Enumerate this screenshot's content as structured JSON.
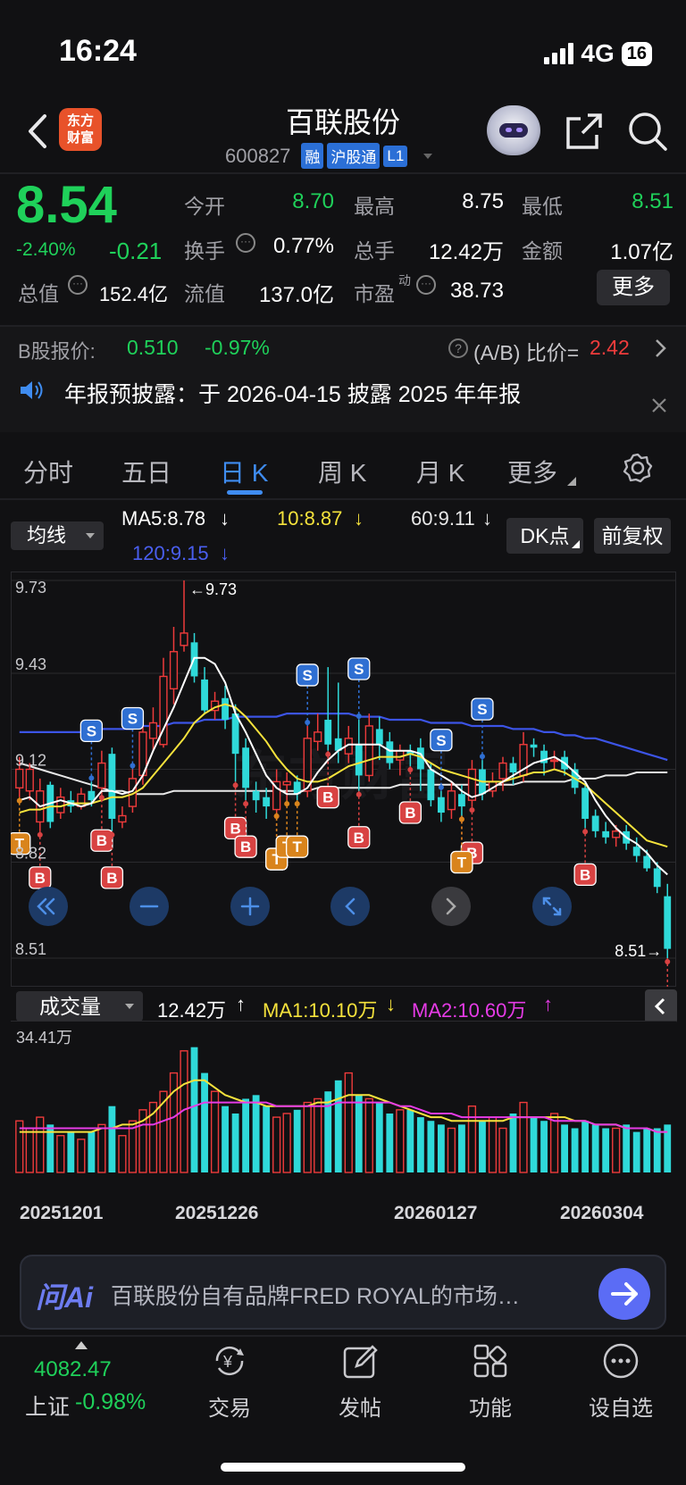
{
  "status_bar": {
    "time": "16:24",
    "network": "4G",
    "battery": "16"
  },
  "header": {
    "logo_text": [
      "东方",
      "财富"
    ],
    "stock_name": "百联股份",
    "stock_code": "600827",
    "tags": [
      "融",
      "沪股通",
      "L1"
    ]
  },
  "quote": {
    "price": "8.54",
    "change_pct": "-2.40%",
    "change": "-0.21",
    "fields": [
      {
        "label": "今开",
        "value": "8.70",
        "color": "green"
      },
      {
        "label": "最高",
        "value": "8.75",
        "color": "white"
      },
      {
        "label": "最低",
        "value": "8.51",
        "color": "green"
      },
      {
        "label": "换手",
        "value": "0.77%",
        "color": "white"
      },
      {
        "label": "总手",
        "value": "12.42万",
        "color": "white"
      },
      {
        "label": "金额",
        "value": "1.07亿",
        "color": "white"
      },
      {
        "label": "总值",
        "value": "152.4亿",
        "color": "white"
      },
      {
        "label": "流值",
        "value": "137.0亿",
        "color": "white"
      },
      {
        "label": "市盈",
        "superscript": "动",
        "value": "38.73",
        "color": "white"
      }
    ],
    "more_label": "更多"
  },
  "b_share": {
    "label": "B股报价:",
    "price": "0.510",
    "change_pct": "-0.97%",
    "ratio_label": "(A/B) 比价=",
    "ratio_value": "2.42"
  },
  "notice": {
    "text": "年报预披露：于 2026-04-15 披露 2025 年年报"
  },
  "tabs": [
    {
      "label": "分时",
      "active": false
    },
    {
      "label": "五日",
      "active": false
    },
    {
      "label": "日 K",
      "active": true
    },
    {
      "label": "周 K",
      "active": false
    },
    {
      "label": "月 K",
      "active": false
    },
    {
      "label": "更多",
      "active": false
    }
  ],
  "indicators": {
    "ma_select": "均线",
    "ma5": "MA5:8.78",
    "ma10": "10:8.87",
    "ma60": "60:9.11",
    "ma120": "120:9.15",
    "dk_label": "DK点",
    "fq_label": "前复权",
    "colors": {
      "ma5": "#ffffff",
      "ma10": "#f5e23c",
      "ma60": "#e8e8e8",
      "ma120": "#3c54e6",
      "up": "#ee3b3b",
      "down": "#2fd9d9"
    }
  },
  "price_axis": {
    "labels": [
      "9.73",
      "9.43",
      "9.12",
      "8.82",
      "8.51"
    ],
    "high_marker": "9.73",
    "low_marker": "8.51"
  },
  "volume": {
    "select": "成交量",
    "current": "12.42万",
    "ma1": "MA1:10.10万",
    "ma2": "MA2:10.60万",
    "max_label": "34.41万"
  },
  "dates": [
    "20251201",
    "20251226",
    "20260127",
    "20260304"
  ],
  "chart_data": {
    "type": "candlestick",
    "ylim": [
      8.51,
      9.73
    ],
    "candles": [
      [
        9.06,
        9.12,
        9.16,
        9.03
      ],
      [
        9.05,
        9.12,
        9.14,
        9.02
      ],
      [
        8.95,
        9.05,
        9.09,
        8.92
      ],
      [
        9.07,
        8.95,
        9.08,
        8.93
      ],
      [
        8.98,
        9.03,
        9.06,
        8.96
      ],
      [
        9.02,
        9.0,
        9.05,
        8.98
      ],
      [
        9.0,
        9.04,
        9.06,
        8.99
      ],
      [
        9.05,
        9.02,
        9.08,
        9.0
      ],
      [
        9.06,
        9.14,
        9.18,
        9.04
      ],
      [
        9.17,
        8.96,
        9.19,
        8.92
      ],
      [
        8.95,
        8.97,
        9.0,
        8.93
      ],
      [
        9.0,
        9.09,
        9.12,
        8.98
      ],
      [
        9.1,
        9.24,
        9.26,
        9.07
      ],
      [
        9.22,
        9.27,
        9.32,
        9.18
      ],
      [
        9.2,
        9.42,
        9.48,
        9.19
      ],
      [
        9.38,
        9.5,
        9.58,
        9.33
      ],
      [
        9.52,
        9.56,
        9.73,
        9.5
      ],
      [
        9.53,
        9.42,
        9.56,
        9.4
      ],
      [
        9.41,
        9.31,
        9.45,
        9.3
      ],
      [
        9.31,
        9.34,
        9.37,
        9.28
      ],
      [
        9.35,
        9.28,
        9.39,
        9.25
      ],
      [
        9.3,
        9.17,
        9.33,
        9.08
      ],
      [
        9.19,
        9.06,
        9.22,
        9.02
      ],
      [
        9.05,
        9.02,
        9.08,
        8.98
      ],
      [
        9.03,
        9.0,
        9.06,
        8.96
      ],
      [
        8.99,
        9.08,
        9.12,
        8.98
      ],
      [
        9.07,
        9.08,
        9.11,
        9.02
      ],
      [
        9.08,
        9.04,
        9.1,
        9.02
      ],
      [
        9.05,
        9.22,
        9.26,
        9.03
      ],
      [
        9.21,
        9.24,
        9.3,
        9.18
      ],
      [
        9.28,
        9.2,
        9.45,
        9.18
      ],
      [
        9.22,
        9.18,
        9.4,
        9.14
      ],
      [
        9.17,
        9.22,
        9.26,
        9.14
      ],
      [
        9.2,
        9.1,
        9.28,
        9.05
      ],
      [
        9.1,
        9.26,
        9.3,
        9.08
      ],
      [
        9.25,
        9.2,
        9.29,
        9.15
      ],
      [
        9.21,
        9.14,
        9.24,
        9.12
      ],
      [
        9.15,
        9.18,
        9.2,
        9.1
      ],
      [
        9.18,
        9.17,
        9.2,
        9.13
      ],
      [
        9.19,
        9.12,
        9.22,
        9.05
      ],
      [
        9.12,
        9.02,
        9.14,
        9.0
      ],
      [
        9.03,
        8.98,
        9.05,
        8.95
      ],
      [
        8.99,
        9.05,
        9.08,
        8.96
      ],
      [
        9.04,
        9.0,
        9.07,
        8.97
      ],
      [
        9.02,
        9.12,
        9.15,
        9.0
      ],
      [
        9.12,
        9.04,
        9.15,
        9.02
      ],
      [
        9.05,
        9.08,
        9.11,
        9.03
      ],
      [
        9.09,
        9.14,
        9.16,
        9.05
      ],
      [
        9.14,
        9.11,
        9.16,
        9.07
      ],
      [
        9.1,
        9.2,
        9.24,
        9.08
      ],
      [
        9.2,
        9.19,
        9.22,
        9.16
      ],
      [
        9.18,
        9.14,
        9.2,
        9.1
      ],
      [
        9.15,
        9.15,
        9.18,
        9.12
      ],
      [
        9.16,
        9.12,
        9.18,
        9.1
      ],
      [
        9.12,
        9.06,
        9.14,
        9.04
      ],
      [
        9.06,
        8.96,
        9.08,
        8.93
      ],
      [
        8.97,
        8.92,
        8.99,
        8.9
      ],
      [
        8.92,
        8.9,
        8.95,
        8.88
      ],
      [
        8.9,
        8.92,
        8.94,
        8.87
      ],
      [
        8.92,
        8.88,
        8.94,
        8.86
      ],
      [
        8.87,
        8.84,
        8.9,
        8.82
      ],
      [
        8.84,
        8.8,
        8.86,
        8.79
      ],
      [
        8.8,
        8.74,
        8.82,
        8.72
      ],
      [
        8.71,
        8.54,
        8.75,
        8.51
      ]
    ],
    "ma5": [
      9.02,
      9.03,
      9.0,
      9.01,
      9.02,
      9.01,
      9.0,
      9.01,
      9.05,
      9.05,
      9.04,
      9.05,
      9.1,
      9.18,
      9.25,
      9.32,
      9.4,
      9.48,
      9.48,
      9.46,
      9.4,
      9.3,
      9.24,
      9.17,
      9.1,
      9.06,
      9.04,
      9.04,
      9.06,
      9.11,
      9.15,
      9.18,
      9.2,
      9.2,
      9.2,
      9.2,
      9.18,
      9.18,
      9.18,
      9.17,
      9.12,
      9.1,
      9.08,
      9.05,
      9.03,
      9.04,
      9.06,
      9.08,
      9.1,
      9.12,
      9.14,
      9.15,
      9.16,
      9.14,
      9.11,
      9.08,
      9.02,
      8.97,
      8.93,
      8.9,
      8.88,
      8.85,
      8.81,
      8.78
    ],
    "ma10": [
      8.98,
      8.99,
      8.99,
      9.0,
      9.0,
      9.01,
      9.01,
      9.01,
      9.02,
      9.03,
      9.03,
      9.04,
      9.06,
      9.1,
      9.14,
      9.18,
      9.22,
      9.27,
      9.3,
      9.32,
      9.33,
      9.32,
      9.29,
      9.25,
      9.21,
      9.16,
      9.12,
      9.09,
      9.08,
      9.08,
      9.09,
      9.11,
      9.13,
      9.14,
      9.15,
      9.16,
      9.16,
      9.16,
      9.17,
      9.16,
      9.14,
      9.12,
      9.11,
      9.1,
      9.09,
      9.08,
      9.08,
      9.08,
      9.09,
      9.1,
      9.11,
      9.11,
      9.12,
      9.11,
      9.09,
      9.07,
      9.04,
      9.01,
      8.98,
      8.95,
      8.92,
      8.89,
      8.88,
      8.87
    ],
    "ma60": [
      9.14,
      9.13,
      9.12,
      9.11,
      9.1,
      9.09,
      9.08,
      9.07,
      9.06,
      9.05,
      9.05,
      9.04,
      9.04,
      9.04,
      9.04,
      9.05,
      9.05,
      9.05,
      9.05,
      9.05,
      9.05,
      9.05,
      9.05,
      9.05,
      9.05,
      9.05,
      9.05,
      9.05,
      9.05,
      9.06,
      9.06,
      9.06,
      9.06,
      9.06,
      9.06,
      9.06,
      9.06,
      9.07,
      9.07,
      9.07,
      9.07,
      9.07,
      9.07,
      9.07,
      9.07,
      9.07,
      9.07,
      9.07,
      9.07,
      9.08,
      9.08,
      9.08,
      9.08,
      9.08,
      9.09,
      9.09,
      9.09,
      9.1,
      9.1,
      9.1,
      9.11,
      9.11,
      9.11,
      9.11
    ],
    "ma120": [
      9.24,
      9.24,
      9.24,
      9.24,
      9.24,
      9.24,
      9.24,
      9.25,
      9.25,
      9.25,
      9.25,
      9.25,
      9.26,
      9.26,
      9.26,
      9.27,
      9.27,
      9.27,
      9.28,
      9.28,
      9.28,
      9.29,
      9.29,
      9.29,
      9.29,
      9.29,
      9.3,
      9.3,
      9.3,
      9.3,
      9.3,
      9.3,
      9.3,
      9.29,
      9.29,
      9.29,
      9.28,
      9.28,
      9.28,
      9.28,
      9.27,
      9.27,
      9.27,
      9.27,
      9.26,
      9.26,
      9.26,
      9.26,
      9.25,
      9.25,
      9.25,
      9.24,
      9.24,
      9.23,
      9.23,
      9.22,
      9.22,
      9.21,
      9.2,
      9.19,
      9.18,
      9.17,
      9.16,
      9.15
    ],
    "volumes": [
      14,
      12,
      15,
      13,
      10,
      11,
      9,
      11,
      13,
      18,
      10,
      14,
      17,
      19,
      22,
      27,
      33,
      34,
      27,
      22,
      18,
      16,
      20,
      21,
      18,
      15,
      16,
      17,
      19,
      20,
      22,
      25,
      27,
      21,
      20,
      19,
      16,
      17,
      17,
      15,
      14,
      13,
      12,
      13,
      18,
      14,
      15,
      12,
      16,
      19,
      15,
      14,
      16,
      13,
      12,
      14,
      13,
      12,
      12,
      13,
      11,
      12,
      12,
      13
    ],
    "vol_ma1": [
      11,
      11,
      11,
      11,
      11,
      11,
      11,
      11,
      12,
      12,
      13,
      13,
      14,
      16,
      19,
      22,
      24,
      25,
      25,
      23,
      21,
      20,
      19,
      19,
      18,
      18,
      18,
      18,
      18,
      19,
      19,
      20,
      21,
      21,
      21,
      20,
      19,
      18,
      17,
      16,
      15,
      15,
      14,
      14,
      14,
      14,
      14,
      14,
      15,
      15,
      15,
      15,
      15,
      15,
      14,
      14,
      13,
      13,
      13,
      12,
      12,
      12,
      11,
      11
    ],
    "vol_ma2": [
      12,
      12,
      12,
      12,
      12,
      12,
      12,
      12,
      12,
      12,
      12,
      12,
      13,
      13,
      14,
      15,
      17,
      18,
      19,
      19,
      19,
      19,
      19,
      19,
      19,
      18,
      18,
      18,
      18,
      18,
      18,
      19,
      19,
      19,
      19,
      19,
      19,
      18,
      18,
      17,
      16,
      16,
      16,
      15,
      15,
      15,
      15,
      15,
      15,
      15,
      15,
      15,
      14,
      14,
      14,
      14,
      13,
      13,
      13,
      12,
      12,
      12,
      11,
      11
    ],
    "markers_b": [
      2,
      8,
      9,
      21,
      22,
      25,
      30,
      33,
      38,
      43,
      44,
      55,
      63
    ],
    "markers_s": [
      7,
      11,
      28,
      33,
      41,
      45
    ],
    "markers_t": [
      0,
      25,
      26,
      27,
      43
    ]
  },
  "ai_bar": {
    "logo": "问Ai",
    "text": "百联股份自有品牌FRED ROYAL的市场…"
  },
  "bottom_nav": {
    "index_value": "4082.47",
    "index_name": "上证",
    "index_change": "-0.98%",
    "items": [
      {
        "label": "交易",
        "icon": "yuan-refresh-icon"
      },
      {
        "label": "发帖",
        "icon": "edit-icon"
      },
      {
        "label": "功能",
        "icon": "grid-icon"
      },
      {
        "label": "设自选",
        "icon": "more-dots-icon"
      }
    ]
  }
}
